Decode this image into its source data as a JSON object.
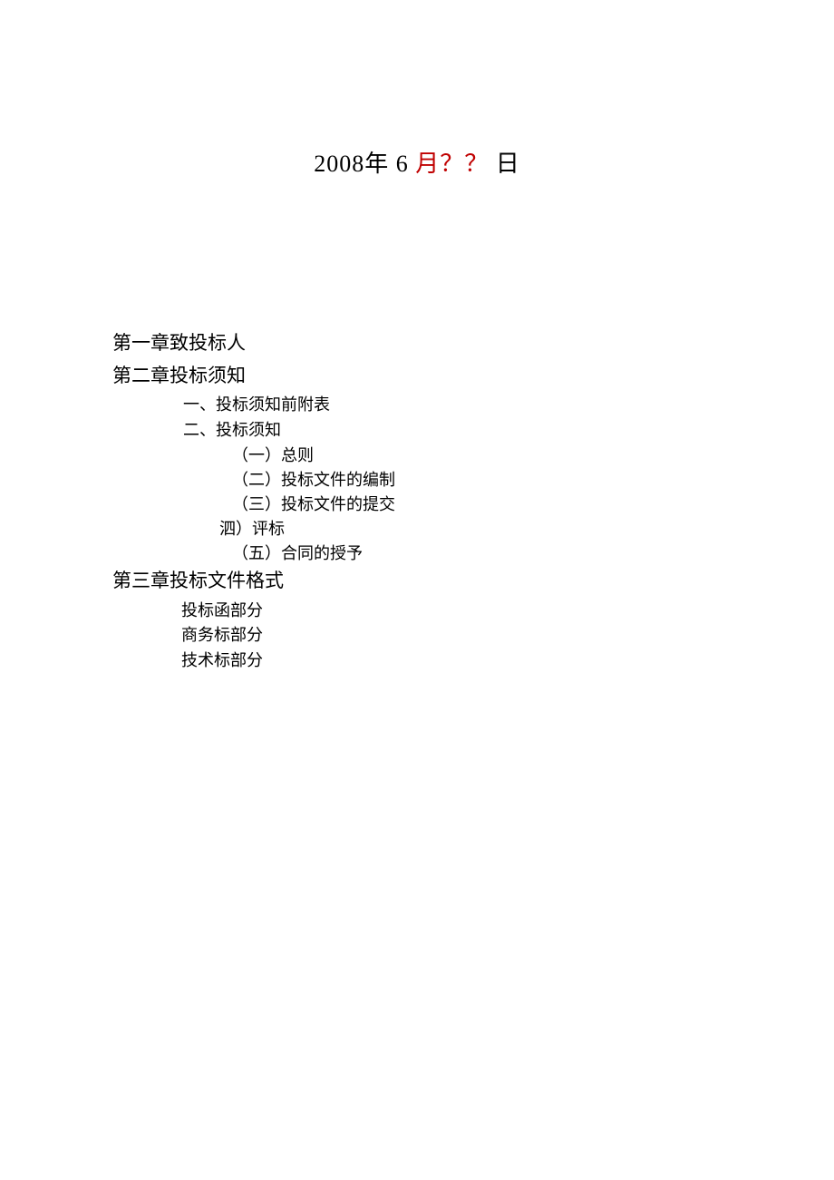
{
  "date": {
    "year_text": "2008",
    "year_suffix": "年",
    "month_text": "6",
    "month_label": "月",
    "placeholder": "？？",
    "day_label": "日"
  },
  "toc": {
    "chapter1": "第一章致投标人",
    "chapter2": "第二章投标须知",
    "chapter2_items": {
      "item1": "一、投标须知前附表",
      "item2": "二、投标须知",
      "sub1": "（一）总则",
      "sub2": "（二）投标文件的编制",
      "sub3": "（三）投标文件的提交",
      "sub4": "泗）评标",
      "sub5": "（五）合同的授予"
    },
    "chapter3": "第三章投标文件格式",
    "chapter3_items": {
      "item1": "投标函部分",
      "item2": "商务标部分",
      "item3": "技术标部分"
    }
  }
}
